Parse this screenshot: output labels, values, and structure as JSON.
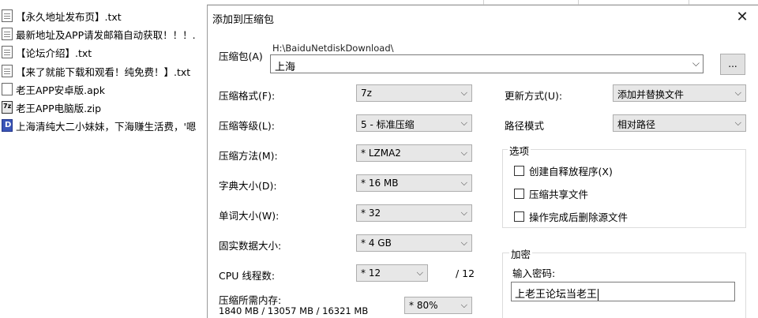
{
  "file_list": {
    "items": [
      {
        "name": "【永久地址发布页】.txt",
        "icon": "txt-file-icon",
        "type": "txt"
      },
      {
        "name": "最新地址及APP请发邮箱自动获取！！！.",
        "icon": "txt-file-icon",
        "type": "txt"
      },
      {
        "name": "【论坛介绍】.txt",
        "icon": "txt-file-icon",
        "type": "txt"
      },
      {
        "name": "【来了就能下载和观看！纯免费！】.txt",
        "icon": "txt-file-icon",
        "type": "txt"
      },
      {
        "name": "老王APP安卓版.apk",
        "icon": "apk-file-icon",
        "type": "apk"
      },
      {
        "name": "老王APP电脑版.zip",
        "icon": "zip-file-icon",
        "type": "zip"
      },
      {
        "name": "上海清纯大二小妹妹，下海赚生活费，'嗯",
        "icon": "video-file-icon",
        "type": "video"
      }
    ]
  },
  "dialog": {
    "title": "添加到压缩包",
    "close_glyph": "✕",
    "archive_label": "压缩包(A)",
    "archive_path": "H:\\BaiduNetdiskDownload\\",
    "archive_name": "上海",
    "browse_label": "...",
    "format_label": "压缩格式(F):",
    "format_value": "7z",
    "level_label": "压缩等级(L):",
    "level_value": "5 - 标准压缩",
    "method_label": "压缩方法(M):",
    "method_value": "* LZMA2",
    "dict_label": "字典大小(D):",
    "dict_value": "* 16 MB",
    "word_label": "单词大小(W):",
    "word_value": "* 32",
    "solid_label": "固实数据大小:",
    "solid_value": "* 4 GB",
    "threads_label": "CPU 线程数:",
    "threads_value": "* 12",
    "threads_total": "/ 12",
    "memory_label": "压缩所需内存:",
    "memory_detail": "1840 MB / 13057 MB / 16321 MB",
    "memory_value": "* 80%",
    "update_label": "更新方式(U):",
    "update_value": "添加并替换文件",
    "pathmode_label": "路径模式",
    "pathmode_value": "相对路径",
    "options_title": "选项",
    "options": [
      {
        "label": "创建自释放程序(X)",
        "checked": false
      },
      {
        "label": "压缩共享文件",
        "checked": false
      },
      {
        "label": "操作完成后删除源文件",
        "checked": false
      }
    ],
    "encryption_title": "加密",
    "password_label": "输入密码:",
    "password_value": "上老王论坛当老王",
    "dropdown_glyph": "⌵"
  }
}
